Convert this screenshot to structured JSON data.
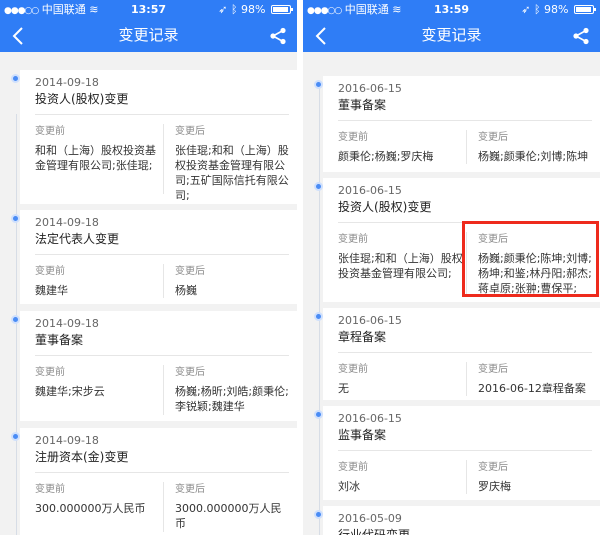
{
  "left": {
    "status": {
      "carrier": "中国联通",
      "time": "13:57",
      "battery": "98%"
    },
    "title": "变更记录",
    "records": [
      {
        "date": "2014-09-18",
        "type": "投资人(股权)变更",
        "before_label": "变更前",
        "after_label": "变更后",
        "before": "和和（上海）股权投资基金管理有限公司;张佳琨;",
        "after": "张佳琨;和和（上海）股权投资基金管理有限公司;五矿国际信托有限公司;"
      },
      {
        "date": "2014-09-18",
        "type": "法定代表人变更",
        "before_label": "变更前",
        "after_label": "变更后",
        "before": "魏建华",
        "after": "杨巍"
      },
      {
        "date": "2014-09-18",
        "type": "董事备案",
        "before_label": "变更前",
        "after_label": "变更后",
        "before": "魏建华;宋步云",
        "after": "杨巍;杨昕;刘皓;颜秉伦;李锐颖;魏建华"
      },
      {
        "date": "2014-09-18",
        "type": "注册资本(金)变更",
        "before_label": "变更前",
        "after_label": "变更后",
        "before": "300.000000万人民币",
        "after": "3000.000000万人民币"
      }
    ]
  },
  "right": {
    "status": {
      "carrier": "中国联通",
      "time": "13:59",
      "battery": "98%"
    },
    "title": "变更记录",
    "records": [
      {
        "date": "2016-06-15",
        "type": "董事备案",
        "before_label": "变更前",
        "after_label": "变更后",
        "before": "颜秉伦;杨巍;罗庆梅",
        "after": "杨巍;颜秉伦;刘博;陈坤"
      },
      {
        "date": "2016-06-15",
        "type": "投资人(股权)变更",
        "before_label": "变更前",
        "after_label": "变更后",
        "before": "张佳琨;和和（上海）股权投资基金管理有限公司;",
        "after": "杨巍;颜秉伦;陈坤;刘博;杨坤;和鉴;林丹阳;郝杰;蒋卓原;张翀;曹保平;"
      },
      {
        "date": "2016-06-15",
        "type": "章程备案",
        "before_label": "变更前",
        "after_label": "变更后",
        "before": "无",
        "after": "2016-06-12章程备案"
      },
      {
        "date": "2016-06-15",
        "type": "监事备案",
        "before_label": "变更前",
        "after_label": "变更后",
        "before": "刘冰",
        "after": "罗庆梅"
      },
      {
        "date": "2016-05-09",
        "type": "行业代码变更"
      }
    ]
  },
  "colors": {
    "accent": "#2f7df6",
    "highlight": "#ee2a1c"
  },
  "icons": {
    "back": "chevron-left-icon",
    "share": "share-icon",
    "wifi": "wifi-icon",
    "location": "location-icon",
    "bluetooth": "bluetooth-icon",
    "battery": "battery-icon"
  }
}
